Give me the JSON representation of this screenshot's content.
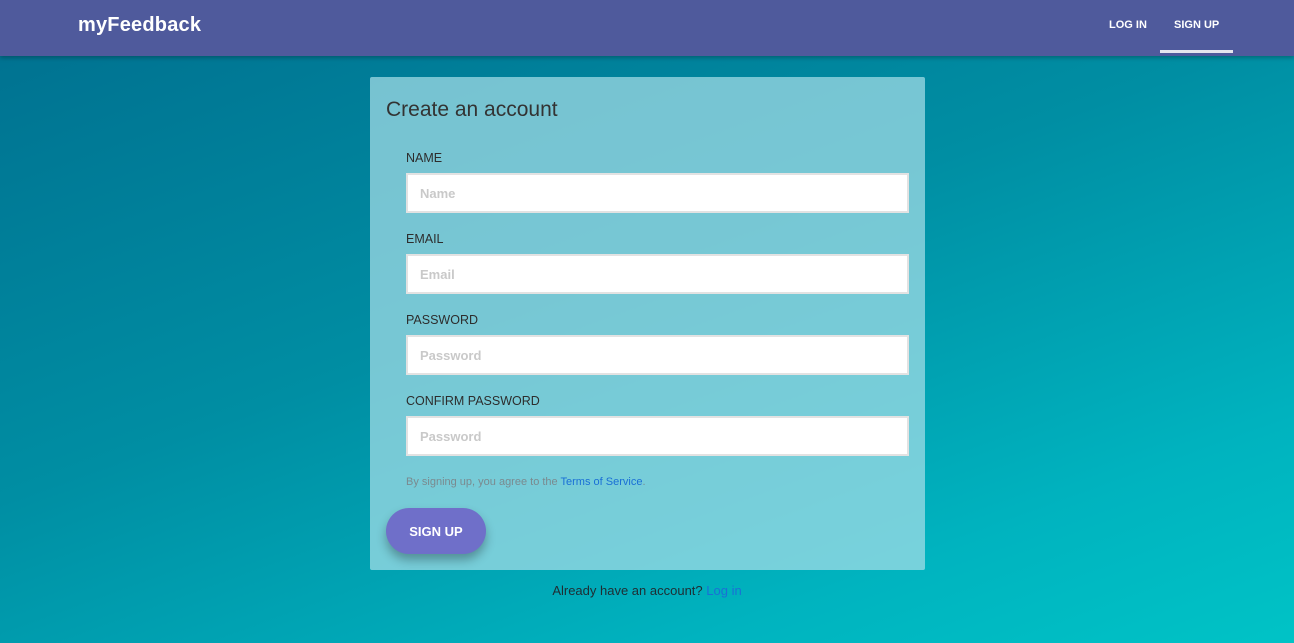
{
  "nav": {
    "brand": "myFeedback",
    "links": [
      {
        "label": "LOG IN",
        "active": false
      },
      {
        "label": "SIGN UP",
        "active": true
      }
    ],
    "colors": {
      "background": "#4f5a9c",
      "active_underline": "#e6e6ee"
    }
  },
  "form": {
    "title": "Create an account",
    "fields": [
      {
        "label": "NAME",
        "placeholder": "Name",
        "value": ""
      },
      {
        "label": "EMAIL",
        "placeholder": "Email",
        "value": ""
      },
      {
        "label": "PASSWORD",
        "placeholder": "Password",
        "value": ""
      },
      {
        "label": "CONFIRM PASSWORD",
        "placeholder": "Password",
        "value": ""
      }
    ],
    "terms_prefix": "By signing up, you agree to the",
    "terms_link": "Terms of Service",
    "terms_suffix": ".",
    "submit_label": "SIGN UP",
    "colors": {
      "button": "#6f6fc9",
      "link": "#1a6fd6"
    }
  },
  "footer": {
    "prompt": "Already have an account?",
    "login_link": "Log in"
  }
}
